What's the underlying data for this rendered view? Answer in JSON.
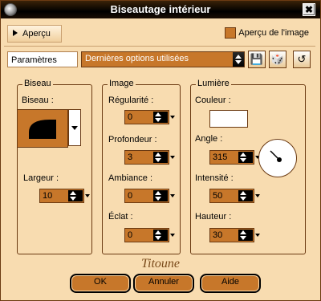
{
  "window": {
    "title": "Biseautage intérieur",
    "close_label": "✖"
  },
  "apercu": {
    "label": "Aperçu",
    "checkbox_label": "Aperçu de l'image"
  },
  "parametres": {
    "label": "Paramètres",
    "preset_value": "Dernières options utilisées"
  },
  "toolbar": {
    "save_icon": "💾",
    "random_icon": "🎲",
    "reset_icon": "↺"
  },
  "groups": {
    "biseau": "Biseau",
    "image": "Image",
    "lumiere": "Lumière"
  },
  "biseau": {
    "label": "Biseau :",
    "largeur_label": "Largeur :",
    "largeur_value": "10"
  },
  "image": {
    "regularite_label": "Régularité :",
    "regularite_value": "0",
    "profondeur_label": "Profondeur :",
    "profondeur_value": "3",
    "ambiance_label": "Ambiance :",
    "ambiance_value": "0",
    "eclat_label": "Éclat :",
    "eclat_value": "0"
  },
  "lumiere": {
    "couleur_label": "Couleur :",
    "couleur_value": "#ffffff",
    "angle_label": "Angle :",
    "angle_value": "315",
    "intensite_label": "Intensité :",
    "intensite_value": "50",
    "hauteur_label": "Hauteur :",
    "hauteur_value": "30"
  },
  "watermark": "Titoune",
  "buttons": {
    "ok": "OK",
    "annuler": "Annuler",
    "aide": "Aide"
  },
  "colors": {
    "accent": "#c7772a",
    "panel": "#f8dcb0",
    "border": "#6b3a12"
  }
}
